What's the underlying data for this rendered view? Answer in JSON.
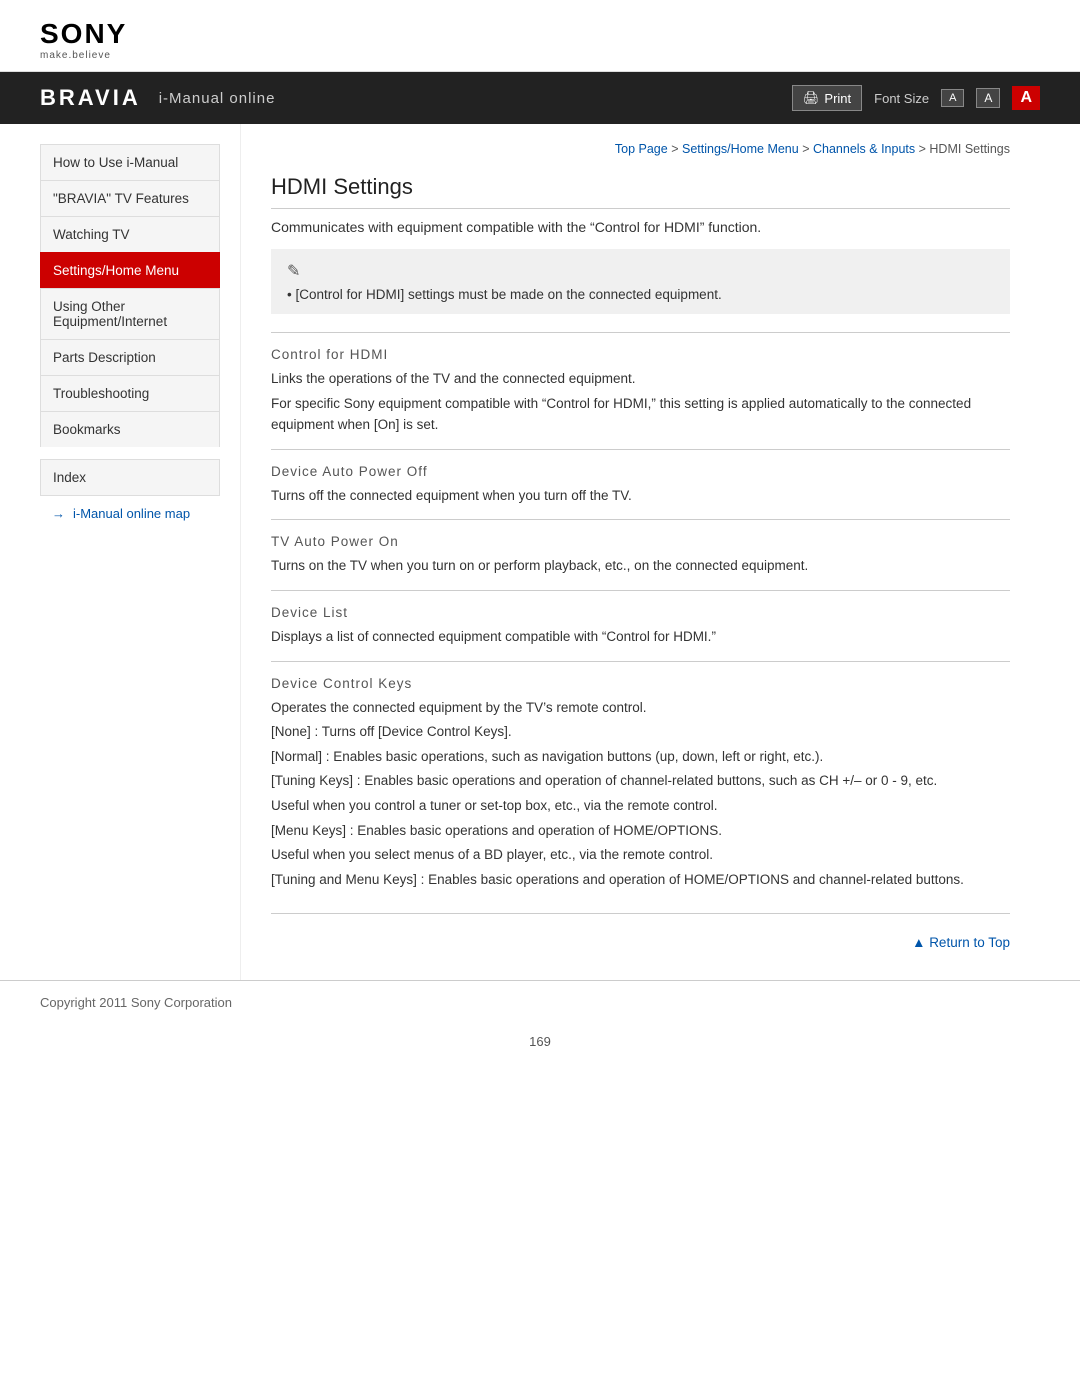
{
  "header": {
    "sony_logo": "SONY",
    "sony_tagline": "make.believe",
    "bravia_logo": "BRAVIA",
    "bravia_subtitle": "i-Manual online",
    "print_label": "Print",
    "font_size_label": "Font Size",
    "font_small": "A",
    "font_medium": "A",
    "font_large": "A"
  },
  "breadcrumb": {
    "top_page": "Top Page",
    "sep1": " > ",
    "settings": "Settings/Home Menu",
    "sep2": " > ",
    "channels": "Channels & Inputs",
    "sep3": " > ",
    "current": "HDMI Settings"
  },
  "sidebar": {
    "items": [
      {
        "label": "How to Use i-Manual",
        "active": false
      },
      {
        "label": "\"BRAVIA\" TV Features",
        "active": false
      },
      {
        "label": "Watching TV",
        "active": false
      },
      {
        "label": "Settings/Home Menu",
        "active": true
      },
      {
        "label": "Using Other Equipment/Internet",
        "active": false
      },
      {
        "label": "Parts Description",
        "active": false
      },
      {
        "label": "Troubleshooting",
        "active": false
      },
      {
        "label": "Bookmarks",
        "active": false
      }
    ],
    "index_label": "Index",
    "map_link": "i-Manual online map"
  },
  "content": {
    "page_title": "HDMI Settings",
    "intro": "Communicates with equipment compatible with the “Control for HDMI” function.",
    "note_text": "[Control for HDMI] settings must be made on the connected equipment.",
    "sections": [
      {
        "title": "Control for HDMI",
        "lines": [
          "Links the operations of the TV and the connected equipment.",
          "For specific Sony equipment compatible with “Control for HDMI,” this setting is applied automatically to the connected equipment when [On] is set."
        ]
      },
      {
        "title": "Device Auto Power Off",
        "lines": [
          "Turns off the connected equipment when you turn off the TV."
        ]
      },
      {
        "title": "TV Auto Power On",
        "lines": [
          "Turns on the TV when you turn on or perform playback, etc., on the connected equipment."
        ]
      },
      {
        "title": "Device List",
        "lines": [
          "Displays a list of connected equipment compatible with “Control for HDMI.”"
        ]
      },
      {
        "title": "Device Control Keys",
        "lines": [
          "Operates the connected equipment by the TV’s remote control.",
          "[None] : Turns off [Device Control Keys].",
          "[Normal] : Enables basic operations, such as navigation buttons (up, down, left or right, etc.).",
          "[Tuning Keys] : Enables basic operations and operation of channel-related buttons, such as CH +/– or 0 - 9, etc.",
          "Useful when you control a tuner or set-top box, etc., via the remote control.",
          "[Menu Keys] : Enables basic operations and operation of HOME/OPTIONS.",
          "Useful when you select menus of a BD player, etc., via the remote control.",
          "[Tuning and Menu Keys] : Enables basic operations and operation of HOME/OPTIONS and channel-related buttons."
        ]
      }
    ],
    "return_to_top": "Return to Top"
  },
  "footer": {
    "copyright": "Copyright 2011 Sony Corporation",
    "page_number": "169"
  }
}
